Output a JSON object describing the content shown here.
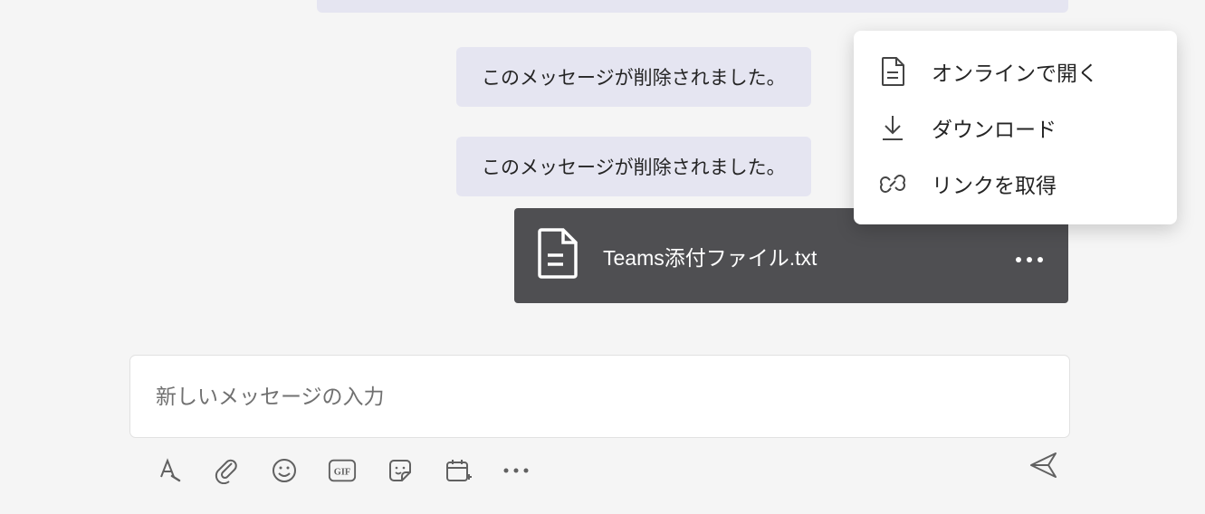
{
  "messages": {
    "deleted1": "このメッセージが削除されました。",
    "deleted2": "このメッセージが削除されました。"
  },
  "attachment": {
    "filename": "Teams添付ファイル.txt"
  },
  "context_menu": {
    "open_online": "オンラインで開く",
    "download": "ダウンロード",
    "get_link": "リンクを取得"
  },
  "compose": {
    "placeholder": "新しいメッセージの入力"
  }
}
